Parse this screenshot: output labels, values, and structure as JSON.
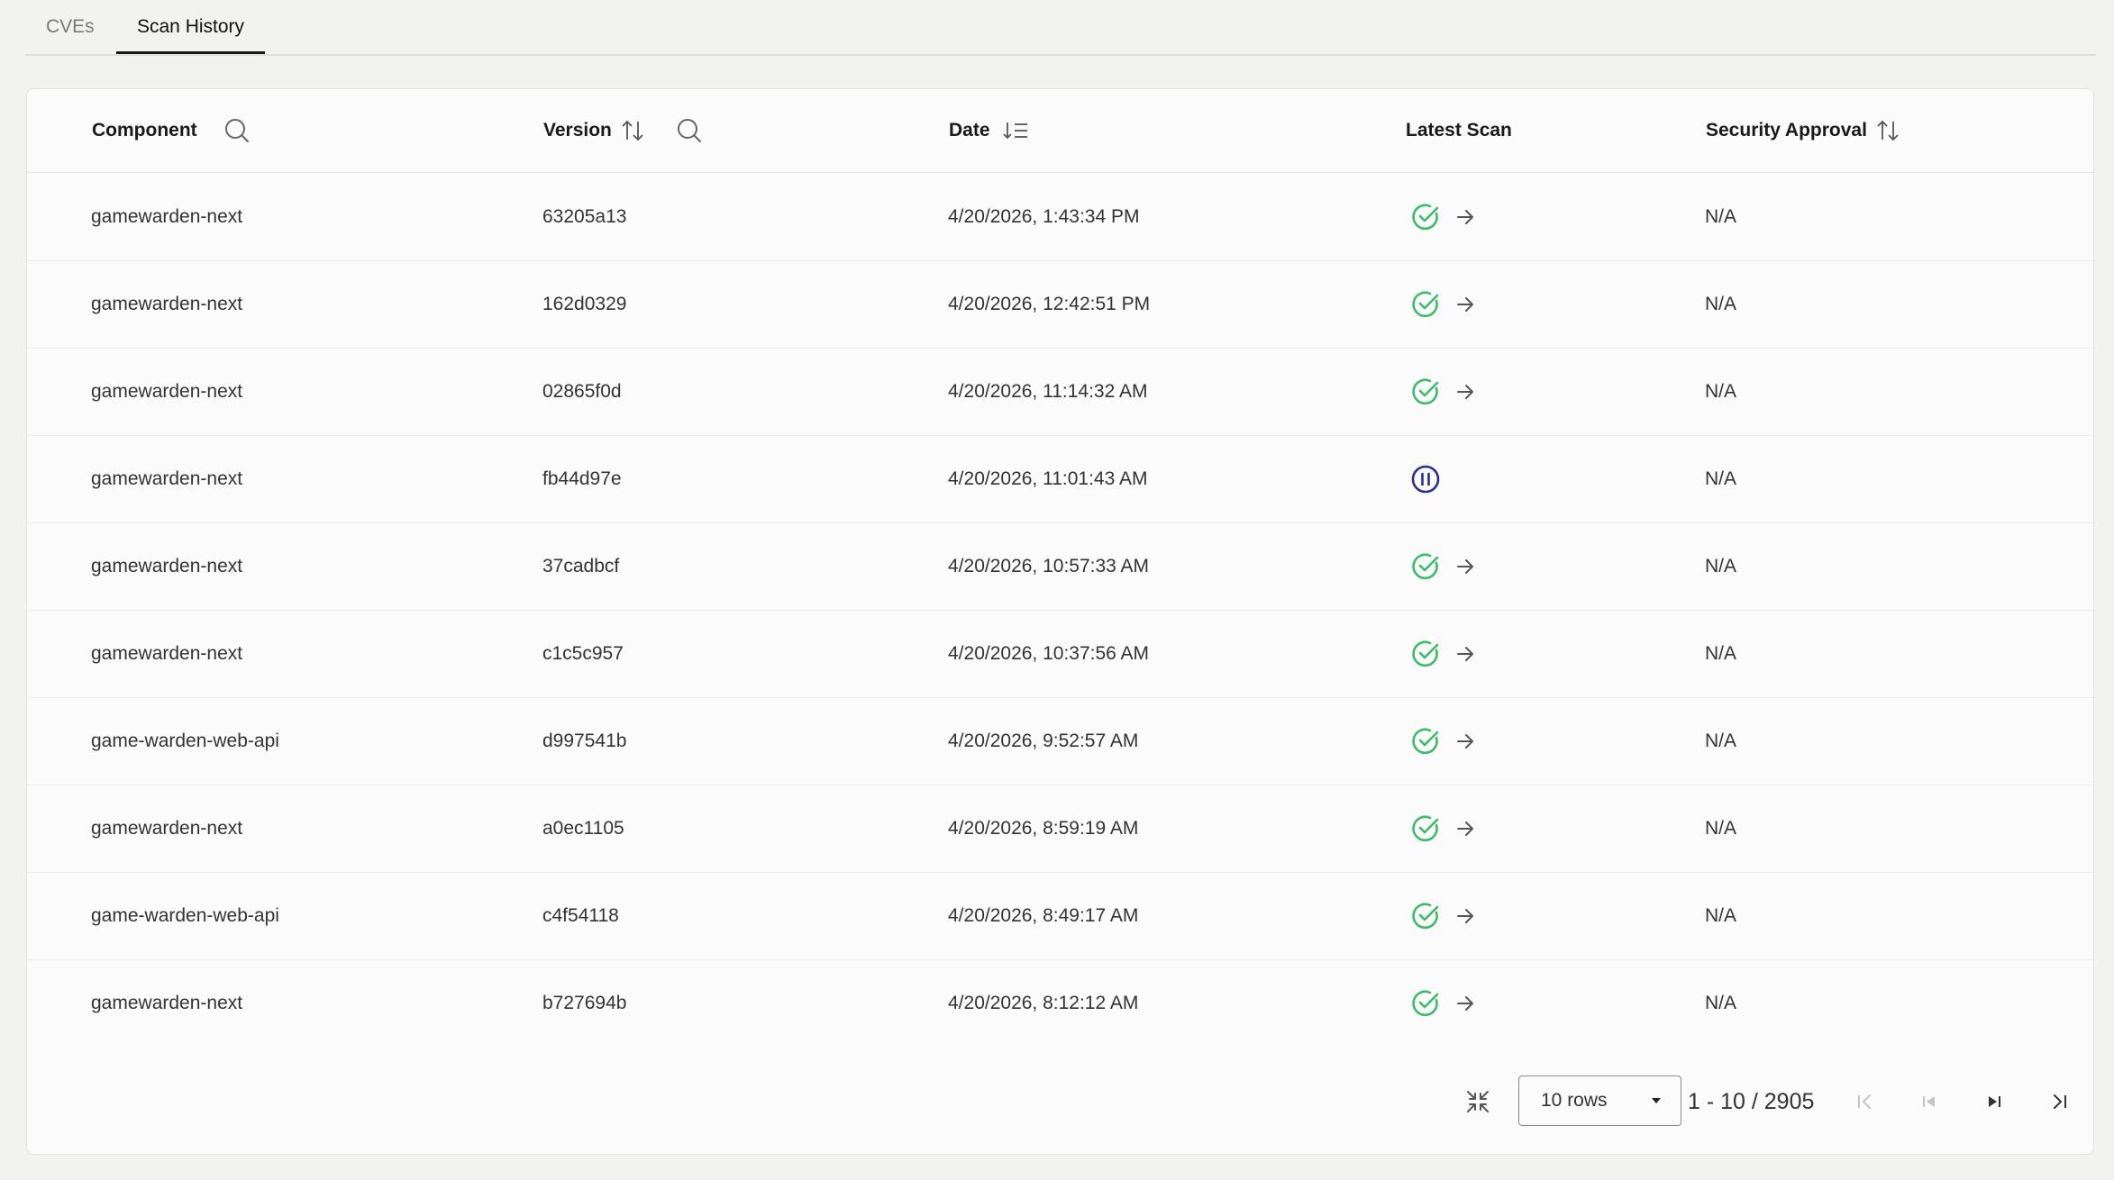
{
  "tabs": [
    {
      "label": "CVEs",
      "active": false
    },
    {
      "label": "Scan History",
      "active": true
    }
  ],
  "table": {
    "columns": {
      "component": "Component",
      "version": "Version",
      "date": "Date",
      "latest_scan": "Latest Scan",
      "security_approval": "Security Approval"
    },
    "rows": [
      {
        "component": "gamewarden-next",
        "version": "63205a13",
        "date": "4/20/2026, 1:43:34 PM",
        "scan_status": "passed",
        "approval": "N/A"
      },
      {
        "component": "gamewarden-next",
        "version": "162d0329",
        "date": "4/20/2026, 12:42:51 PM",
        "scan_status": "passed",
        "approval": "N/A"
      },
      {
        "component": "gamewarden-next",
        "version": "02865f0d",
        "date": "4/20/2026, 11:14:32 AM",
        "scan_status": "passed",
        "approval": "N/A"
      },
      {
        "component": "gamewarden-next",
        "version": "fb44d97e",
        "date": "4/20/2026, 11:01:43 AM",
        "scan_status": "paused",
        "approval": "N/A"
      },
      {
        "component": "gamewarden-next",
        "version": "37cadbcf",
        "date": "4/20/2026, 10:57:33 AM",
        "scan_status": "passed",
        "approval": "N/A"
      },
      {
        "component": "gamewarden-next",
        "version": "c1c5c957",
        "date": "4/20/2026, 10:37:56 AM",
        "scan_status": "passed",
        "approval": "N/A"
      },
      {
        "component": "game-warden-web-api",
        "version": "d997541b",
        "date": "4/20/2026, 9:52:57 AM",
        "scan_status": "passed",
        "approval": "N/A"
      },
      {
        "component": "gamewarden-next",
        "version": "a0ec1105",
        "date": "4/20/2026, 8:59:19 AM",
        "scan_status": "passed",
        "approval": "N/A"
      },
      {
        "component": "game-warden-web-api",
        "version": "c4f54118",
        "date": "4/20/2026, 8:49:17 AM",
        "scan_status": "passed",
        "approval": "N/A"
      },
      {
        "component": "gamewarden-next",
        "version": "b727694b",
        "date": "4/20/2026, 8:12:12 AM",
        "scan_status": "passed",
        "approval": "N/A"
      }
    ]
  },
  "pagination": {
    "rows_per_page": "10 rows",
    "range": "1 - 10 / 2905"
  },
  "icons": {
    "search": "search-icon",
    "sort": "sort-icon",
    "sort_desc": "sort-descending-icon",
    "passed": "check-circle-icon",
    "paused": "pause-circle-icon",
    "arrow": "arrow-right-icon",
    "collapse": "collapse-icon",
    "first_page": "first-page-icon",
    "prev_page": "previous-page-icon",
    "next_page": "next-page-icon",
    "last_page": "last-page-icon"
  },
  "colors": {
    "passed": "#3dbb6a",
    "paused": "#2b2f8f",
    "text": "#333333"
  }
}
